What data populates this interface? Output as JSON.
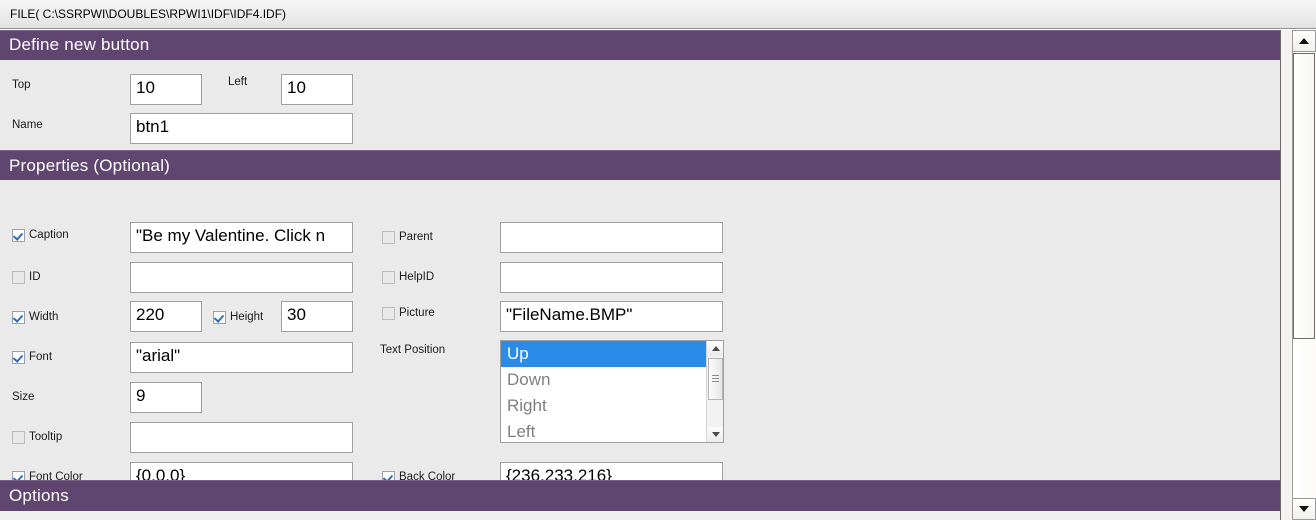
{
  "titlebar": {
    "filepath": "FILE( C:\\SSRPWI\\DOUBLES\\RPWI1\\IDF\\IDF4.IDF)"
  },
  "sections": {
    "define": "Define new button",
    "properties": "Properties (Optional)",
    "options": "Options"
  },
  "define_fields": {
    "top_label": "Top",
    "top_value": "10",
    "left_label": "Left",
    "left_value": "10",
    "name_label": "Name",
    "name_value": "btn1"
  },
  "properties_left": [
    {
      "label": "Caption",
      "checked": true,
      "value": "\"Be my Valentine.  Click n"
    },
    {
      "label": "ID",
      "checked": false,
      "value": ""
    },
    {
      "label": "Width",
      "checked": true,
      "value": "220"
    },
    {
      "label": "Height",
      "checked": true,
      "value": "30"
    },
    {
      "label": "Font",
      "checked": true,
      "value": "\"arial\""
    },
    {
      "label": "Size",
      "checked": null,
      "value": "9"
    },
    {
      "label": "Tooltip",
      "checked": false,
      "value": ""
    },
    {
      "label": "Font Color",
      "checked": true,
      "value": "{0,0,0}"
    }
  ],
  "properties_right": [
    {
      "label": "Parent",
      "checked": false,
      "value": ""
    },
    {
      "label": "HelpID",
      "checked": false,
      "value": ""
    },
    {
      "label": "Picture",
      "checked": false,
      "value": "\"FileName.BMP\""
    },
    {
      "label": "Back Color",
      "checked": true,
      "value": "{236,233,216}"
    }
  ],
  "text_position": {
    "label": "Text Position",
    "options": [
      "Up",
      "Down",
      "Right",
      "Left"
    ],
    "selected": "Up"
  },
  "colors": {
    "header_purple": "#5f4570",
    "panel_grey": "#eaeaea",
    "selection_blue": "#2a8ce8",
    "field_white": "#ffffff"
  },
  "icons": {
    "scroll_up": "triangle-up-icon",
    "scroll_down": "triangle-down-icon"
  }
}
